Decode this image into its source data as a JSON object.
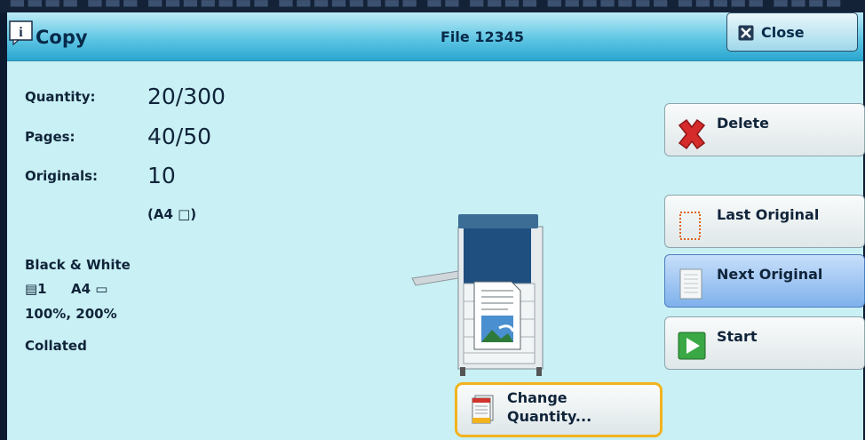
{
  "header": {
    "title": "Copy",
    "file": "File 12345",
    "close_label": "Close"
  },
  "job": {
    "quantity_label": "Quantity:",
    "quantity_value": "20/300",
    "pages_label": "Pages:",
    "pages_value": "40/50",
    "originals_label": "Originals:",
    "originals_value": "10",
    "original_size": "(A4 □)"
  },
  "settings": {
    "color": "Black & White",
    "tray": "▤1",
    "paper": "A4 ▭",
    "zoom": "100%, 200%",
    "finishing": "Collated"
  },
  "actions": {
    "delete": "Delete",
    "last_original": "Last Original",
    "next_original": "Next Original",
    "start": "Start",
    "change_quantity_line1": "Change",
    "change_quantity_line2": "Quantity..."
  },
  "icons": [
    "info-icon",
    "close-x-icon",
    "delete-x-icon",
    "last-original-icon",
    "next-original-icon",
    "start-play-icon",
    "change-quantity-icon",
    "copier-machine-icon"
  ],
  "colors": {
    "panel_bg": "#c9f0f4",
    "header_blue": "#5fc6e4",
    "highlight_blue": "#7fb1ec",
    "focus_orange": "#f2b31e",
    "start_green": "#3aa845",
    "delete_red": "#d62b2b"
  }
}
